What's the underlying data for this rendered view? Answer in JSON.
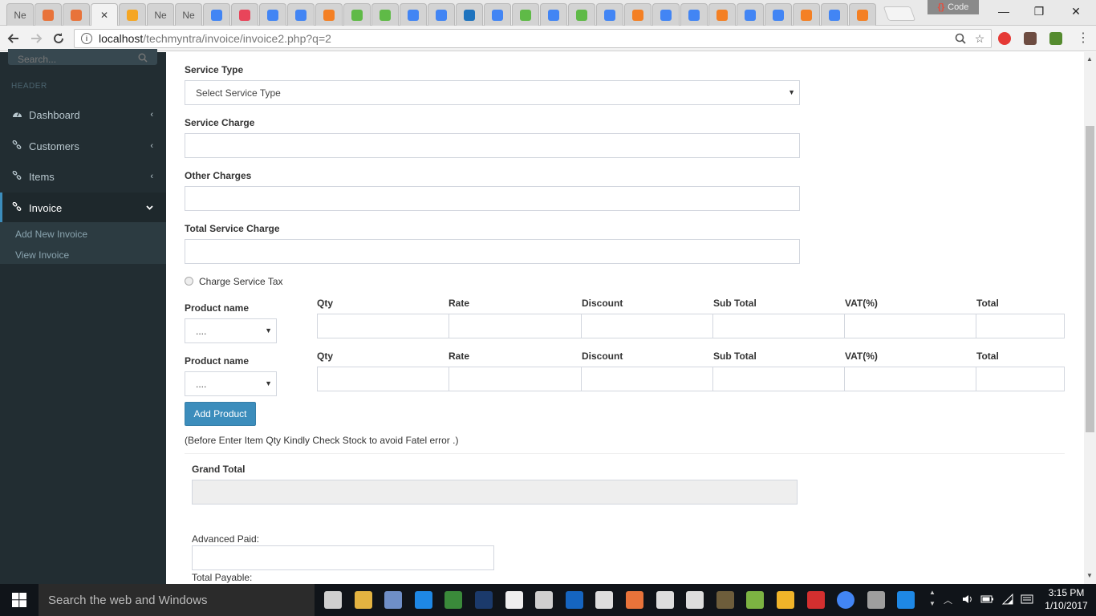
{
  "browser": {
    "tabs": [
      {
        "label": "Ne",
        "color": "#9e9e9e"
      },
      {
        "label": "",
        "color": "#e8733a"
      },
      {
        "label": "",
        "color": "#e8733a"
      },
      {
        "label": "",
        "color": "#f2f2f2",
        "active": true
      },
      {
        "label": "",
        "color": "#f5a623"
      },
      {
        "label": "Ne",
        "color": "#9e9e9e"
      },
      {
        "label": "Ne",
        "color": "#9e9e9e"
      },
      {
        "label": "",
        "color": "#4285f4"
      },
      {
        "label": "",
        "color": "#e8455a"
      },
      {
        "label": "",
        "color": "#4285f4"
      },
      {
        "label": "",
        "color": "#4285f4"
      },
      {
        "label": "",
        "color": "#f48024"
      },
      {
        "label": "",
        "color": "#5fba47"
      },
      {
        "label": "",
        "color": "#5fba47"
      },
      {
        "label": "",
        "color": "#4285f4"
      },
      {
        "label": "",
        "color": "#4285f4"
      },
      {
        "label": "",
        "color": "#1e73be"
      },
      {
        "label": "",
        "color": "#4285f4"
      },
      {
        "label": "",
        "color": "#5fba47"
      },
      {
        "label": "",
        "color": "#4285f4"
      },
      {
        "label": "",
        "color": "#5fba47"
      },
      {
        "label": "",
        "color": "#4285f4"
      },
      {
        "label": "",
        "color": "#f48024"
      },
      {
        "label": "",
        "color": "#4285f4"
      },
      {
        "label": "",
        "color": "#4285f4"
      },
      {
        "label": "",
        "color": "#f48024"
      },
      {
        "label": "",
        "color": "#4285f4"
      },
      {
        "label": "",
        "color": "#4285f4"
      },
      {
        "label": "",
        "color": "#f48024"
      },
      {
        "label": "",
        "color": "#4285f4"
      },
      {
        "label": "",
        "color": "#f48024"
      }
    ],
    "profile_badge": "Code",
    "url_host": "localhost",
    "url_path": "/techmyntra/invoice/invoice2.php?q=2",
    "minimize_glyph": "—",
    "maximize_glyph": "❐",
    "close_glyph": "✕"
  },
  "sidebar": {
    "search_placeholder": "Search...",
    "header": "HEADER",
    "items": [
      {
        "label": "Dashboard",
        "icon": "dashboard-icon"
      },
      {
        "label": "Customers",
        "icon": "link-icon"
      },
      {
        "label": "Items",
        "icon": "link-icon"
      },
      {
        "label": "Invoice",
        "icon": "link-icon",
        "active": true
      }
    ],
    "subitems": [
      "Add New Invoice",
      "View Invoice"
    ]
  },
  "form": {
    "service_type_label": "Service Type",
    "service_type_value": "Select Service Type",
    "service_charge_label": "Service Charge",
    "other_charges_label": "Other Charges",
    "total_service_charge_label": "Total Service Charge",
    "charge_service_tax_label": "Charge Service Tax",
    "product_rows": [
      {
        "product_label": "Product name",
        "product_value": "....",
        "qty": "Qty",
        "rate": "Rate",
        "discount": "Discount",
        "subtotal": "Sub Total",
        "vat": "VAT(%)",
        "total": "Total"
      },
      {
        "product_label": "Product name",
        "product_value": "....",
        "qty": "Qty",
        "rate": "Rate",
        "discount": "Discount",
        "subtotal": "Sub Total",
        "vat": "VAT(%)",
        "total": "Total"
      }
    ],
    "add_product_button": "Add Product",
    "stock_note": "(Before Enter Item Qty Kindly Check Stock to avoid Fatel error .)",
    "grand_total_label": "Grand Total",
    "advanced_paid_label": "Advanced Paid:",
    "total_payable_label": "Total Payable:"
  },
  "taskbar": {
    "search_placeholder": "Search the web and Windows",
    "time": "3:15 PM",
    "date": "1/10/2017"
  },
  "colors": {
    "sidebar_bg": "#222d32",
    "accent": "#3c8dbc"
  }
}
